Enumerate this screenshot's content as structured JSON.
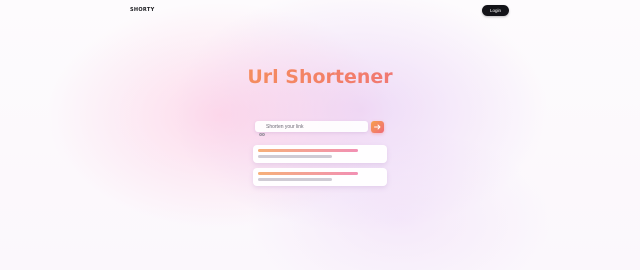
{
  "header": {
    "logo_text": "SHORTY",
    "login_label": "Login"
  },
  "hero": {
    "title": "Url Shortener"
  },
  "search": {
    "placeholder": "Shorten your link",
    "value": "",
    "submit_icon": "arrow-right-icon",
    "field_icon": "link-icon"
  },
  "results": {
    "items": [
      {
        "state": "loading-placeholder"
      },
      {
        "state": "loading-placeholder"
      }
    ]
  },
  "colors": {
    "accent_start": "#f9a84b",
    "accent_end": "#e8669f",
    "login_bg": "#131318",
    "background": "#fbf9fc"
  }
}
